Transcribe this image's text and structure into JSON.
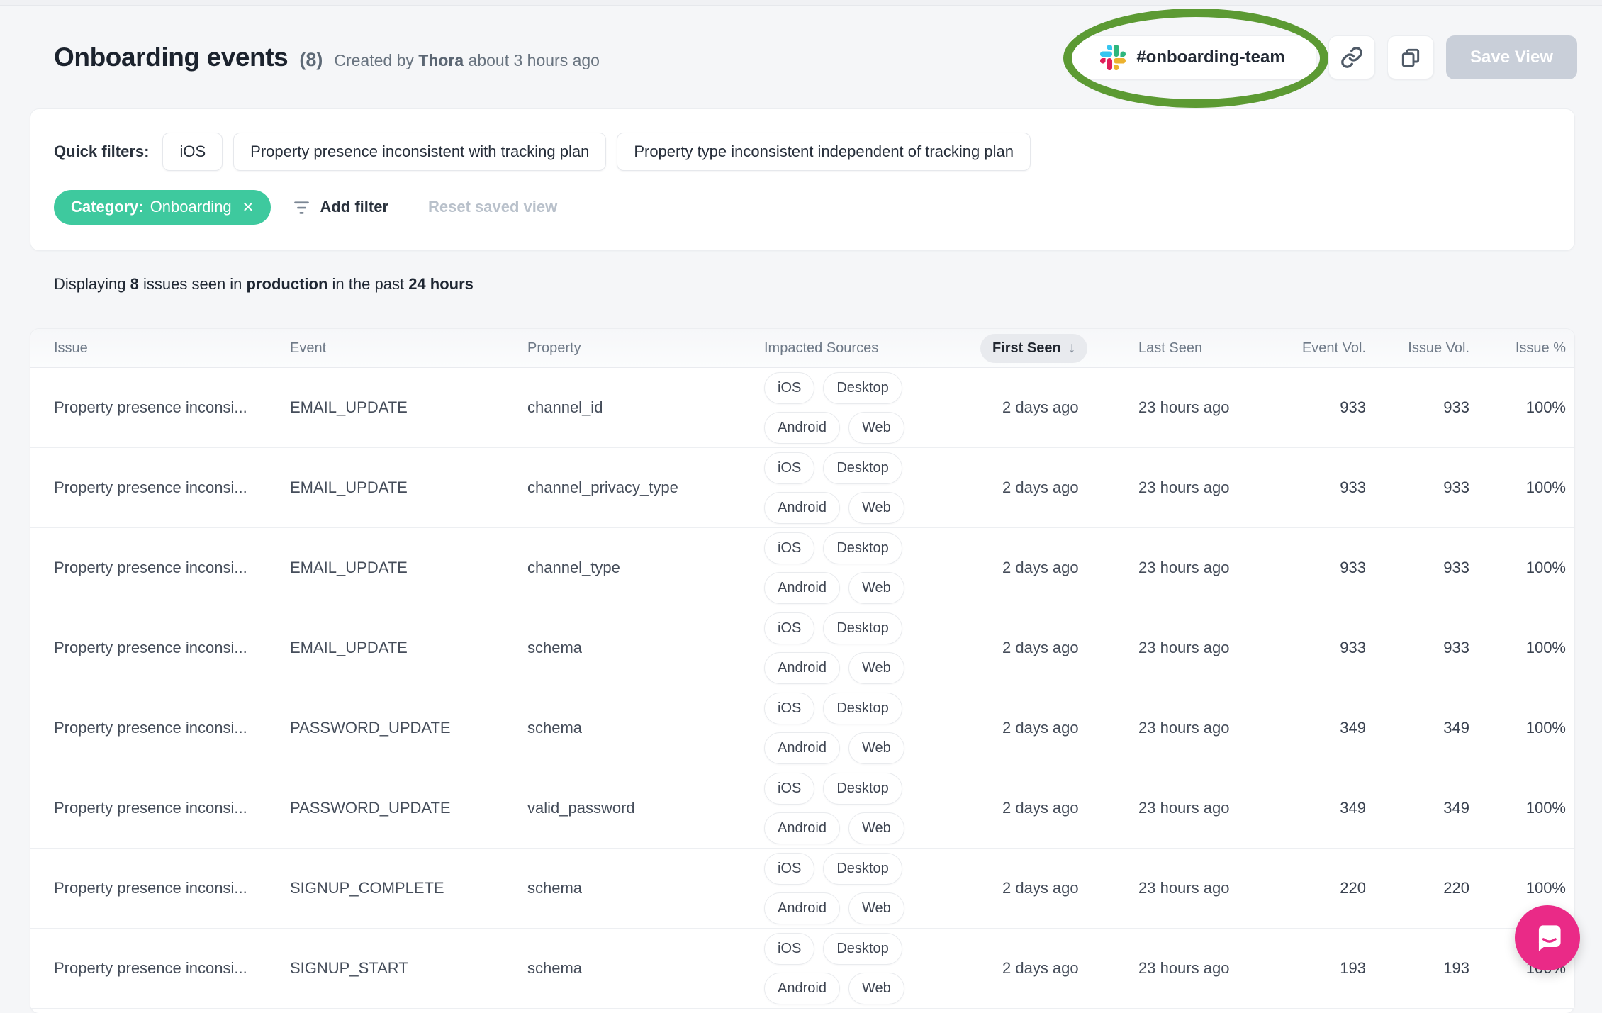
{
  "colors": {
    "page_bg": "#f5f6f8",
    "category_chip_green": "#3ec99e",
    "annotation_green": "#5c9a33",
    "chat_bubble_pink": "#ea2a87",
    "save_view_disabled": "#c9cfd9",
    "slack": {
      "blue": "#36C5F0",
      "green": "#2EB67D",
      "red": "#E01E5A",
      "yellow": "#ECB22E"
    }
  },
  "header": {
    "title": "Onboarding events",
    "count": "(8)",
    "created_prefix": "Created by",
    "created_name": "Thora",
    "created_suffix": "about 3 hours ago",
    "slack_channel": "#onboarding-team",
    "save_view_label": "Save View"
  },
  "filters": {
    "quick_filters_label": "Quick filters:",
    "quick_filters": [
      "iOS",
      "Property presence inconsistent with tracking plan",
      "Property type inconsistent independent of tracking plan"
    ],
    "active_filter": {
      "name": "Category:",
      "value": "Onboarding",
      "close": "✕"
    },
    "add_filter_label": "Add filter",
    "reset_label": "Reset saved view"
  },
  "summary": {
    "prefix": "Displaying",
    "count": "8",
    "mid1": "issues seen in",
    "env": "production",
    "mid2": "in the past",
    "range": "24 hours"
  },
  "table": {
    "columns": {
      "issue": "Issue",
      "event": "Event",
      "property": "Property",
      "impacted_sources": "Impacted Sources",
      "first_seen": "First Seen",
      "sort_arrow": "↓",
      "last_seen": "Last Seen",
      "event_vol": "Event Vol.",
      "issue_vol": "Issue Vol.",
      "issue_pct": "Issue %"
    },
    "rows": [
      {
        "issue": "Property presence inconsi...",
        "event": "EMAIL_UPDATE",
        "property": "channel_id",
        "sources": [
          "iOS",
          "Desktop",
          "Android",
          "Web"
        ],
        "first_seen": "2 days ago",
        "last_seen": "23 hours ago",
        "event_vol": "933",
        "issue_vol": "933",
        "issue_pct": "100%"
      },
      {
        "issue": "Property presence inconsi...",
        "event": "EMAIL_UPDATE",
        "property": "channel_privacy_type",
        "sources": [
          "iOS",
          "Desktop",
          "Android",
          "Web"
        ],
        "first_seen": "2 days ago",
        "last_seen": "23 hours ago",
        "event_vol": "933",
        "issue_vol": "933",
        "issue_pct": "100%"
      },
      {
        "issue": "Property presence inconsi...",
        "event": "EMAIL_UPDATE",
        "property": "channel_type",
        "sources": [
          "iOS",
          "Desktop",
          "Android",
          "Web"
        ],
        "first_seen": "2 days ago",
        "last_seen": "23 hours ago",
        "event_vol": "933",
        "issue_vol": "933",
        "issue_pct": "100%"
      },
      {
        "issue": "Property presence inconsi...",
        "event": "EMAIL_UPDATE",
        "property": "schema",
        "sources": [
          "iOS",
          "Desktop",
          "Android",
          "Web"
        ],
        "first_seen": "2 days ago",
        "last_seen": "23 hours ago",
        "event_vol": "933",
        "issue_vol": "933",
        "issue_pct": "100%"
      },
      {
        "issue": "Property presence inconsi...",
        "event": "PASSWORD_UPDATE",
        "property": "schema",
        "sources": [
          "iOS",
          "Desktop",
          "Android",
          "Web"
        ],
        "first_seen": "2 days ago",
        "last_seen": "23 hours ago",
        "event_vol": "349",
        "issue_vol": "349",
        "issue_pct": "100%"
      },
      {
        "issue": "Property presence inconsi...",
        "event": "PASSWORD_UPDATE",
        "property": "valid_password",
        "sources": [
          "iOS",
          "Desktop",
          "Android",
          "Web"
        ],
        "first_seen": "2 days ago",
        "last_seen": "23 hours ago",
        "event_vol": "349",
        "issue_vol": "349",
        "issue_pct": "100%"
      },
      {
        "issue": "Property presence inconsi...",
        "event": "SIGNUP_COMPLETE",
        "property": "schema",
        "sources": [
          "iOS",
          "Desktop",
          "Android",
          "Web"
        ],
        "first_seen": "2 days ago",
        "last_seen": "23 hours ago",
        "event_vol": "220",
        "issue_vol": "220",
        "issue_pct": "100%"
      },
      {
        "issue": "Property presence inconsi...",
        "event": "SIGNUP_START",
        "property": "schema",
        "sources": [
          "iOS",
          "Desktop",
          "Android",
          "Web"
        ],
        "first_seen": "2 days ago",
        "last_seen": "23 hours ago",
        "event_vol": "193",
        "issue_vol": "193",
        "issue_pct": "100%"
      }
    ]
  }
}
